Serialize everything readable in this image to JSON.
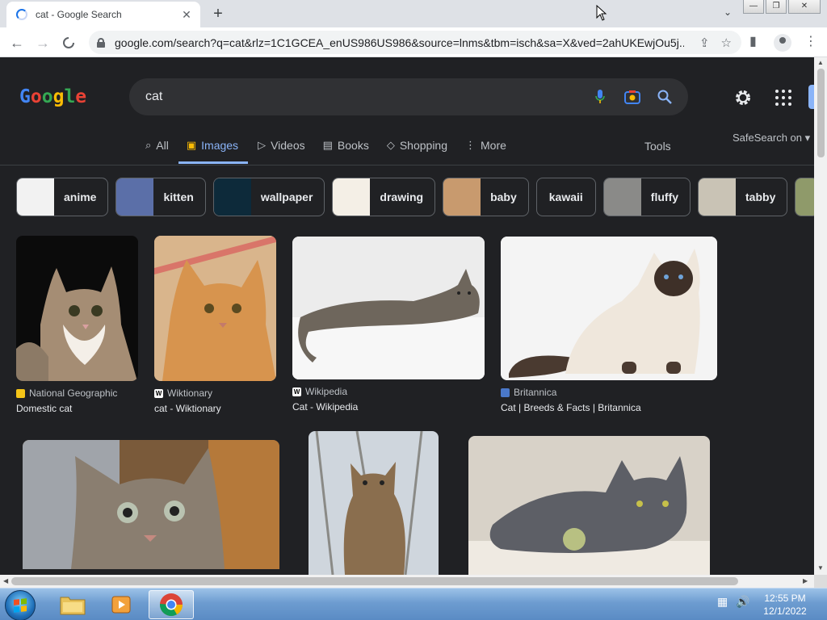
{
  "browser": {
    "tab_title": "cat - Google Search",
    "tab_close": "✕",
    "new_tab": "+",
    "tab_search": "⌄",
    "window_controls": {
      "minimize": "—",
      "restore": "❐",
      "close": "✕"
    },
    "url": "google.com/search?q=cat&rlz=1C1GCEA_enUS986US986&source=lnms&tbm=isch&sa=X&ved=2ahUKEwjOu5j...",
    "back": "←",
    "forward": "→",
    "stop": "✕"
  },
  "google": {
    "logo_letters": [
      {
        "ch": "G",
        "color": "#4285f4"
      },
      {
        "ch": "o",
        "color": "#e94235"
      },
      {
        "ch": "o",
        "color": "#34a853"
      },
      {
        "ch": "g",
        "color": "#fbbc04"
      },
      {
        "ch": "l",
        "color": "#34a853"
      },
      {
        "ch": "e",
        "color": "#e94235"
      }
    ],
    "search_value": "cat",
    "tabs": [
      {
        "label": "All",
        "icon": "search-icon"
      },
      {
        "label": "Images",
        "icon": "image-icon",
        "active": true
      },
      {
        "label": "Videos",
        "icon": "play-icon"
      },
      {
        "label": "Books",
        "icon": "book-icon"
      },
      {
        "label": "Shopping",
        "icon": "tag-icon"
      },
      {
        "label": "More",
        "icon": "more-vert-icon"
      }
    ],
    "tools": "Tools",
    "safesearch": "SafeSearch on ▾",
    "chips": [
      {
        "label": "anime",
        "thumb": "#f2f2f2"
      },
      {
        "label": "kitten",
        "thumb": "#5b6fa8"
      },
      {
        "label": "wallpaper",
        "thumb": "#0d2a3a"
      },
      {
        "label": "drawing",
        "thumb": "#f4efe6"
      },
      {
        "label": "baby",
        "thumb": "#c89a6e"
      },
      {
        "label": "kawaii",
        "thumb": ""
      },
      {
        "label": "fluffy",
        "thumb": "#8a8a88"
      },
      {
        "label": "tabby",
        "thumb": "#c9c3b5"
      }
    ],
    "results_row1": [
      {
        "source": "National Geographic",
        "title": "Domestic cat",
        "fav_color": "#f5c518",
        "fav_text": "",
        "bg": "#0b0b0b",
        "fur": "#a58d74"
      },
      {
        "source": "Wiktionary",
        "title": "cat - Wiktionary",
        "fav_color": "#ffffff",
        "fav_text": "W",
        "bg": "#cf9b63",
        "fur": "#d7944e"
      },
      {
        "source": "Wikipedia",
        "title": "Cat - Wikipedia",
        "fav_color": "#ffffff",
        "fav_text": "W",
        "bg": "#e9e9e9",
        "fur": "#6e665c"
      },
      {
        "source": "Britannica",
        "title": "Cat | Breeds & Facts | Britannica",
        "fav_color": "#4a78c9",
        "fav_text": "",
        "bg": "#f4f4f4",
        "fur": "#efe7dc"
      }
    ]
  },
  "taskbar": {
    "time": "12:55 PM",
    "date": "12/1/2022"
  }
}
